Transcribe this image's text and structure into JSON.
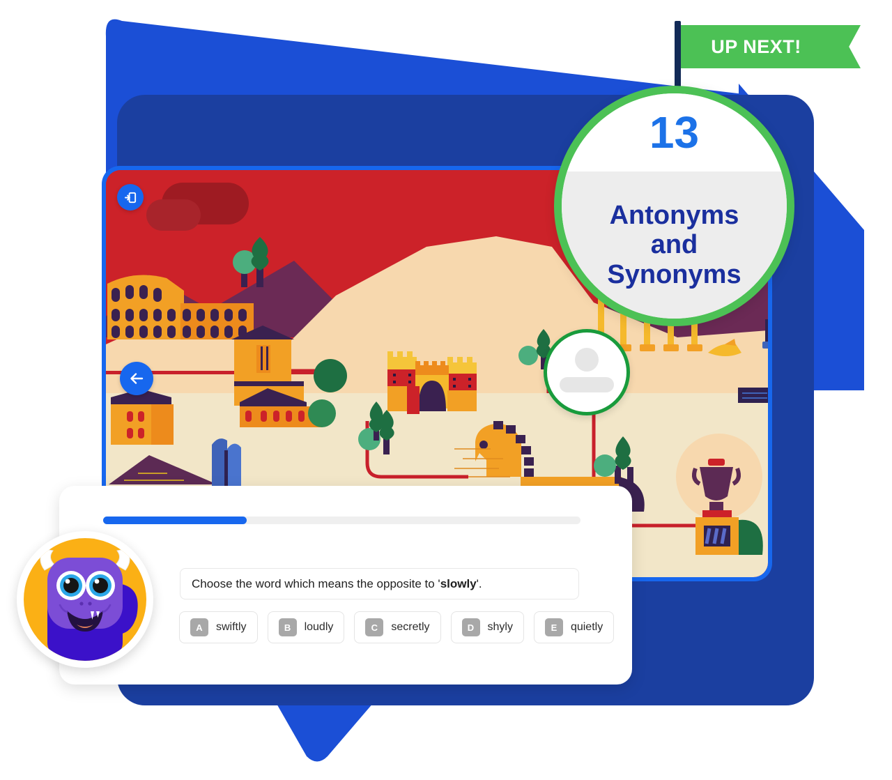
{
  "flag": {
    "label": "UP NEXT!",
    "color": "#4CC155",
    "pole_color": "#122A57"
  },
  "lesson_badge": {
    "number": "13",
    "title_line1": "Antonyms",
    "title_line2": "and",
    "title_line3": "Synonyms",
    "number_color": "#1C72E8",
    "title_color": "#1A2F9E",
    "ring_color": "#4CC155",
    "top_bg": "#FFFFFF",
    "bottom_bg": "#EDEDED"
  },
  "map_screen": {
    "frame_color": "#1767EE",
    "backdrop_color": "#1B3FA0",
    "sky_color": "#CC2229",
    "mountain_color": "#6B2A55",
    "sand_color": "#F7D8AE",
    "ground_color": "#F2E6C8",
    "road_color": "#C8202B",
    "building_color": "#F2A025",
    "exit_button": {
      "icon": "exit-icon",
      "color": "#1767EE"
    },
    "back_button": {
      "icon": "arrow-left-icon",
      "color": "#1767EE"
    },
    "player_node": {
      "icon": "avatar-placeholder-icon",
      "ring_color": "#199B3C"
    }
  },
  "question_card": {
    "progress": {
      "percent": 30,
      "fill_color": "#1767EE",
      "track_color": "#EFEFEF"
    },
    "prompt_prefix": "Choose the word which means the opposite to '",
    "prompt_bold": "slowly",
    "prompt_suffix": "'.",
    "options": [
      {
        "key": "A",
        "label": "swiftly"
      },
      {
        "key": "B",
        "label": "loudly"
      },
      {
        "key": "C",
        "label": "secretly"
      },
      {
        "key": "D",
        "label": "shyly"
      },
      {
        "key": "E",
        "label": "quietly"
      }
    ]
  },
  "avatar": {
    "name": "monster-avatar",
    "disc_color": "#FBB015",
    "body_color": "#3B11C9",
    "face_color": "#7C4DD6",
    "eye_color": "#2BA7E8",
    "horn_color": "#FFFFFF"
  }
}
